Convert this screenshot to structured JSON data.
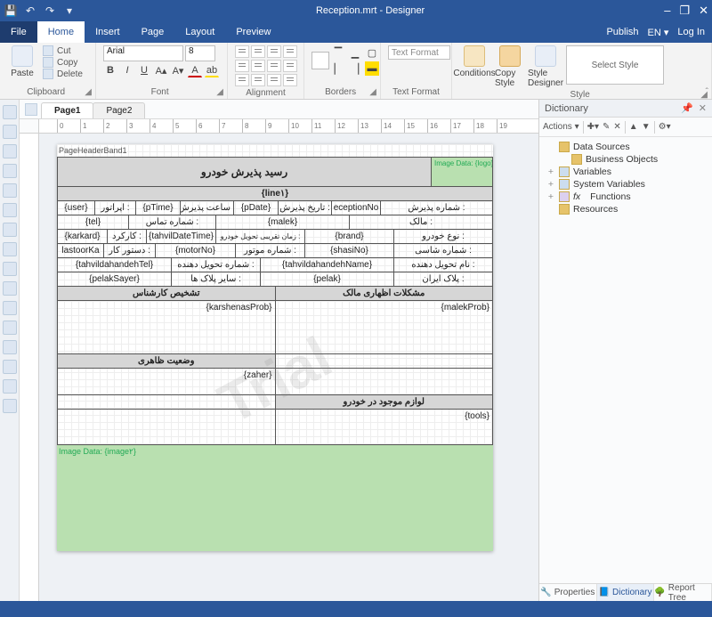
{
  "title": "Reception.mrt - Designer",
  "window_buttons": {
    "min": "–",
    "restore": "❐",
    "close": "✕"
  },
  "menu": {
    "file": "File",
    "tabs": [
      "Home",
      "Insert",
      "Page",
      "Layout",
      "Preview"
    ],
    "active": "Home",
    "publish": "Publish",
    "lang": "EN",
    "login": "Log In"
  },
  "ribbon": {
    "clipboard": {
      "label": "Clipboard",
      "paste": "Paste",
      "cut": "Cut",
      "copy": "Copy",
      "delete": "Delete"
    },
    "font": {
      "label": "Font",
      "family": "Arial",
      "size": "8",
      "bold": "B",
      "italic": "I",
      "underline": "U"
    },
    "alignment": {
      "label": "Alignment"
    },
    "borders": {
      "label": "Borders"
    },
    "textformat": {
      "label": "Text Format",
      "default": "Text Format"
    },
    "style": {
      "label": "Style",
      "conditions": "Conditions",
      "copystyle": "Copy Style",
      "designer": "Style Designer",
      "select": "Select Style"
    }
  },
  "pages": {
    "p1": "Page1",
    "p2": "Page2"
  },
  "ruler": [
    "0",
    "1",
    "2",
    "3",
    "4",
    "5",
    "6",
    "7",
    "8",
    "9",
    "10",
    "11",
    "12",
    "13",
    "14",
    "15",
    "16",
    "17",
    "18",
    "19"
  ],
  "report": {
    "header_band": "PageHeaderBand1",
    "logo": "Image Data: {logo}",
    "title": "رسید پذیرش خودرو",
    "line1": "{line۱}",
    "row1": {
      "recno_l": "شماره پذیرش :",
      "recno_v": "eceptionNo",
      "date_l": "تاریخ پذیرش :",
      "date_v": "{pDate}",
      "time_l": "ساعت پذیرش :",
      "time_v": "{pTime}",
      "op_l": "اپراتور :",
      "op_v": "{user}"
    },
    "row2": {
      "owner_l": "مالک :",
      "owner_v": "{malek}",
      "phone_l": "شماره تماس :",
      "phone_v": "{tel}"
    },
    "row3": {
      "type_l": "نوع خودرو :",
      "type_v": "{brand}",
      "deliv_l": "زمان تقریبی تحویل خودرو :",
      "deliv_v": "{tahvilDateTime}",
      "km_l": "کارکرد :",
      "km_v": "{karkard}"
    },
    "row4": {
      "chno_l": "شماره شاسی :",
      "chno_v": "{shasiNo}",
      "motor_l": "شماره موتور :",
      "motor_v": "{motorNo}",
      "order_l": "دستور کار :",
      "order_v": "lastoorKa"
    },
    "row5": {
      "delivn_l": "نام تحویل دهنده :",
      "delivn_v": "{tahvildahandehName}",
      "delivt_l": "شماره تحویل دهنده :",
      "delivt_v": "{tahvildahandehTel}"
    },
    "row6": {
      "plate_l": "پلاک ایران :",
      "plate_v": "{pelak}",
      "oplate_l": "سایر پلاک ها :",
      "oplate_v": "{pelakSayer}"
    },
    "sec_owner_prob": "مشکلات اظهاری مالک",
    "sec_expert": "تشخیص کارشناس",
    "malek_prob": "{malekProb}",
    "karshenas_prob": "{karshenasProb}",
    "sec_appear": "وضعیت ظاهری",
    "zaher": "{zaher}",
    "sec_tools": "لوازم موجود در خودرو",
    "tools": "{tools}",
    "image2": "Image Data: {image۲}"
  },
  "watermark": "Trial",
  "dictionary": {
    "title": "Dictionary",
    "actions": "Actions",
    "nodes": {
      "ds": "Data Sources",
      "bo": "Business Objects",
      "vars": "Variables",
      "sysvars": "System Variables",
      "fx": "Functions",
      "res": "Resources"
    },
    "tabs": {
      "props": "Properties",
      "dict": "Dictionary",
      "tree": "Report Tree"
    }
  }
}
